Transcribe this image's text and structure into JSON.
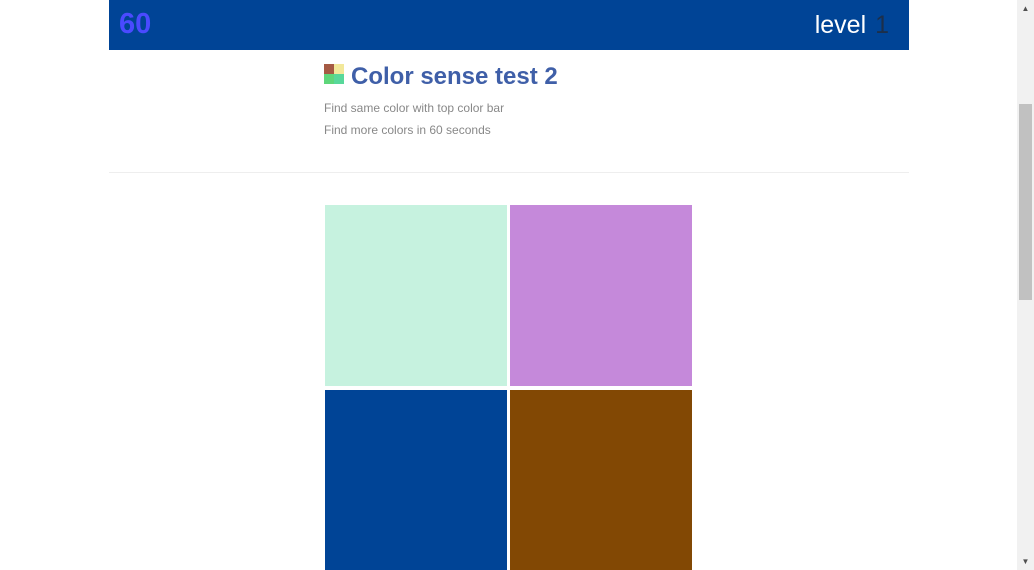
{
  "hud": {
    "timer": "60",
    "level_label": "level",
    "level_value": "1"
  },
  "header": {
    "title": "Color sense test 2",
    "desc_line_1": "Find same color with top color bar",
    "desc_line_2": "Find more colors in 60 seconds",
    "logo_icon": "four-color-squares-icon",
    "logo_colors": [
      "#a55a44",
      "#f2e89a",
      "#5ed67a",
      "#58d89a"
    ]
  },
  "colors": {
    "top_bar": "#004496",
    "timer_text": "#4a4aff",
    "title_text": "#3f5fa8"
  },
  "board": {
    "tiles": [
      {
        "color": "#c6f2df"
      },
      {
        "color": "#c589da"
      },
      {
        "color": "#004496"
      },
      {
        "color": "#824804"
      }
    ]
  },
  "scrollbar": {
    "up_icon": "scroll-up-arrow-icon",
    "down_icon": "scroll-down-arrow-icon"
  }
}
